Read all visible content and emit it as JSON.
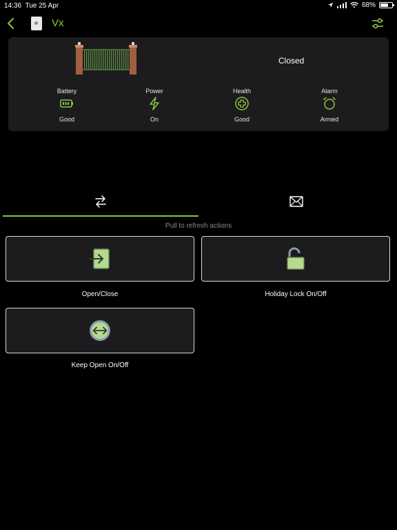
{
  "status": {
    "time": "14:36",
    "date": "Tue 25 Apr",
    "battery": "68%",
    "battery_level": 0.68
  },
  "nav": {
    "title": "Vx"
  },
  "device": {
    "state": "Closed",
    "metrics": [
      {
        "label": "Battery",
        "value": "Good",
        "icon": "battery-icon"
      },
      {
        "label": "Power",
        "value": "On",
        "icon": "lightning-icon"
      },
      {
        "label": "Health",
        "value": "Good",
        "icon": "health-cross-icon"
      },
      {
        "label": "Alarm",
        "value": "Armed",
        "icon": "alarm-clock-icon"
      }
    ]
  },
  "tabs": [
    {
      "name": "actions",
      "icon": "swap-arrows-icon",
      "active": true
    },
    {
      "name": "messages",
      "icon": "envelope-icon",
      "active": false
    }
  ],
  "hint": "Pull to refresh actions",
  "actions": [
    {
      "label": "Open/Close",
      "icon": "enter-door-icon"
    },
    {
      "label": "Holiday Lock On/Off",
      "icon": "open-padlock-icon"
    },
    {
      "label": "Keep Open On/Off",
      "icon": "double-arrow-circle-icon"
    }
  ],
  "colors": {
    "accent": "#8dc63f",
    "card": "#1c1c1e",
    "background": "#000000"
  }
}
